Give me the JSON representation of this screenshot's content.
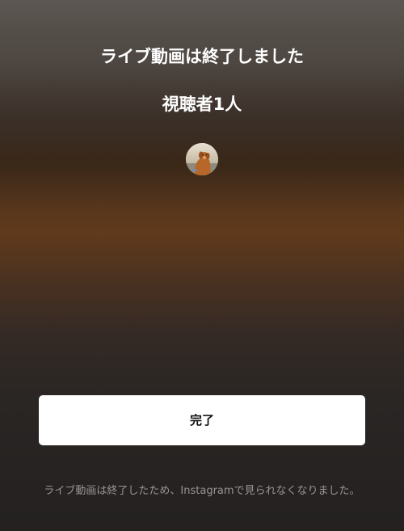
{
  "live_end": {
    "title": "ライブ動画は終了しました",
    "viewers_text": "視聴者1人",
    "avatar_icon": "user-avatar-dog-photo",
    "done_button_label": "完了",
    "footer_note": "ライブ動画は終了したため、Instagramで見られなくなりました。"
  }
}
